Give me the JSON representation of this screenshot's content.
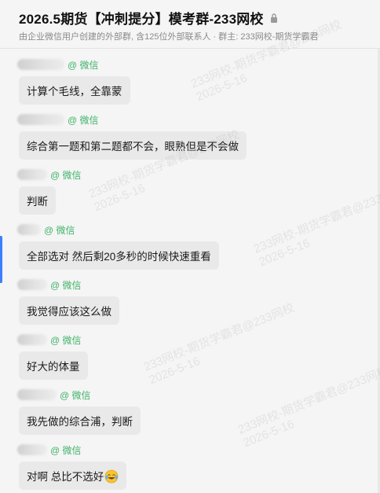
{
  "header": {
    "title": "2026.5期货【冲刺提分】模考群-233网校",
    "subtitle": "由企业微信用户创建的外部群, 含125位外部联系人 · 群主: 233网校-期货学霸君"
  },
  "channel_label": "@ 微信",
  "messages": [
    {
      "text": "计算个毛线，全靠蒙"
    },
    {
      "text": "综合第一题和第二题都不会，眼熟但是不会做"
    },
    {
      "text": "判断"
    },
    {
      "text": "全部选对 然后剩20多秒的时候快速重看"
    },
    {
      "text": "我觉得应该这么做"
    },
    {
      "text": "好大的体量"
    },
    {
      "text": "我先做的综合浦，判断"
    },
    {
      "text": "对啊 总比不选好",
      "emoji": "laughing-tears-emoji"
    }
  ],
  "watermark": {
    "line1": "233网校-期货学霸君@233网校",
    "line2": "2026-5-16"
  },
  "colors": {
    "wechat_green": "#3fb36a",
    "bubble_bg": "#e9e9e9",
    "active_indicator": "#3d7eff"
  }
}
